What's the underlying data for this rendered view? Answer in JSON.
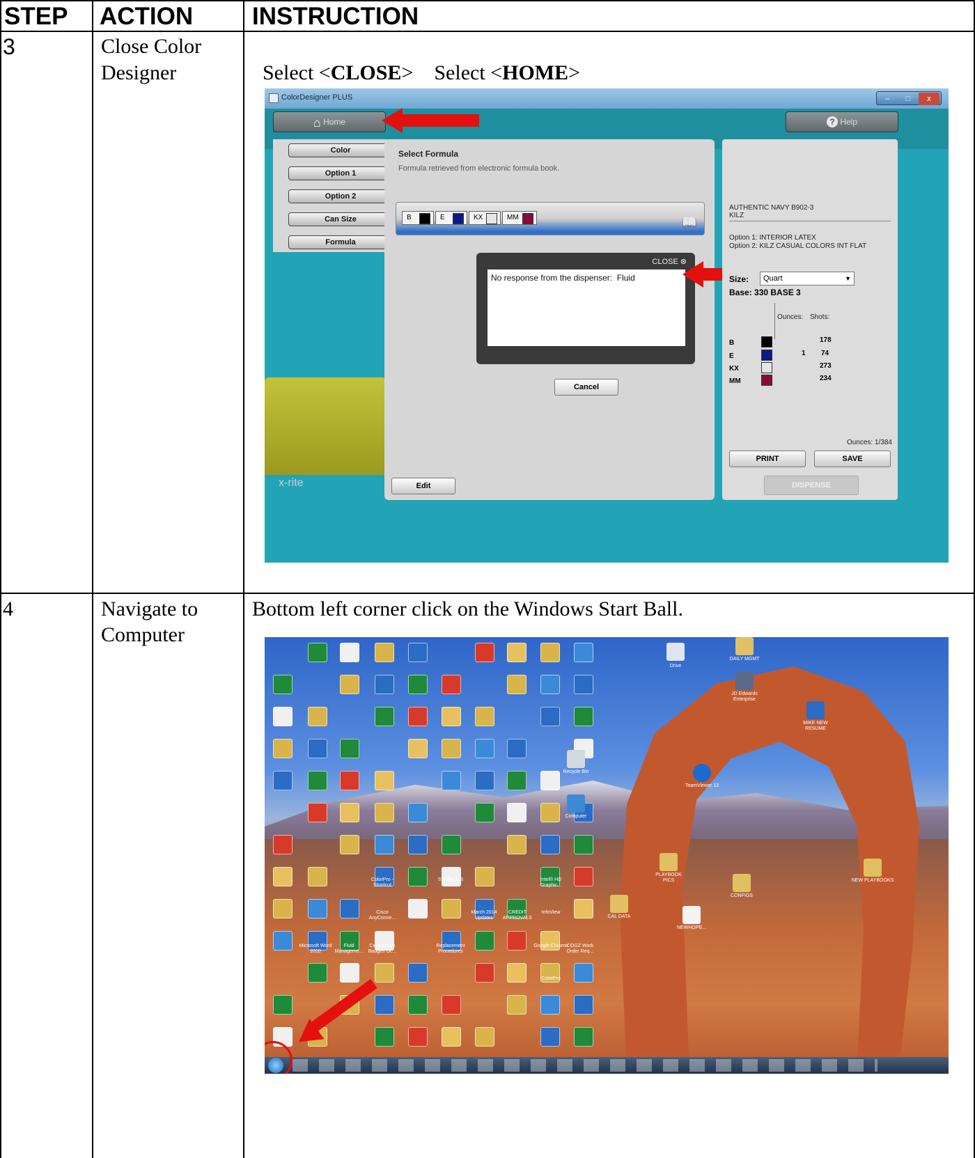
{
  "table": {
    "headers": {
      "step": "STEP",
      "action": "ACTION",
      "instruction": "INSTRUCTION"
    },
    "rows": [
      {
        "step": "3",
        "action_line1": "Close Color",
        "action_line2": "Designer",
        "instruction_prefix1": "Select <",
        "instruction_bold1": "CLOSE",
        "instruction_suffix1": ">",
        "instruction_prefix2": "Select <",
        "instruction_bold2": "HOME",
        "instruction_suffix2": ">"
      },
      {
        "step": "4",
        "action_line1": "Navigate to",
        "action_line2": "Computer",
        "instruction": "Bottom left corner click on the Windows Start Ball."
      }
    ]
  },
  "screenshot1": {
    "window_title": "ColorDesigner PLUS",
    "home_label": "Home",
    "help_label": "Help",
    "nav": [
      "Color",
      "Option 1",
      "Option 2",
      "Can Size",
      "Formula"
    ],
    "select_formula_title": "Select Formula",
    "select_formula_desc": "Formula retrieved from electronic formula book.",
    "colorants": [
      {
        "code": "B",
        "color": "#000000"
      },
      {
        "code": "E",
        "color": "#0a1a8a"
      },
      {
        "code": "KX",
        "color": "#e0e0e0"
      },
      {
        "code": "MM",
        "color": "#8a0a3a"
      }
    ],
    "dialog_close": "CLOSE ⊗",
    "dialog_message": "No response from the dispenser:  Fluid",
    "cancel_label": "Cancel",
    "edit_label": "Edit",
    "product_name": "AUTHENTIC NAVY B902-3",
    "brand": "KILZ",
    "option1": "Option 1:  INTERIOR LATEX",
    "option2": "Option 2:  KILZ CASUAL COLORS INT FLAT",
    "size_label": "Size:",
    "size_value": "Quart",
    "base_label": "Base:  330 BASE 3",
    "ounces_header": "Ounces:",
    "shots_header": "Shots:",
    "formula_rows": [
      {
        "code": "B",
        "color": "#000000",
        "ounces": "",
        "shots": "178"
      },
      {
        "code": "E",
        "color": "#0a1a8a",
        "ounces": "1",
        "shots": "74"
      },
      {
        "code": "KX",
        "color": "#e6e6e6",
        "ounces": "",
        "shots": "273"
      },
      {
        "code": "MM",
        "color": "#8a0a3a",
        "ounces": "",
        "shots": "234"
      }
    ],
    "ounces_total": "Ounces: 1/384",
    "print_label": "PRINT",
    "save_label": "SAVE",
    "dispense_label": "DISPENSE",
    "brand_logo": "x-rite"
  },
  "screenshot2": {
    "desktop_labels": [
      "Drive",
      "DAILY MGMT",
      "JD Edwards Enterprise",
      "MIKE NEW RESUME",
      "Recycle Bin",
      "TeamViewer 13",
      "Computer",
      "PLAYBOOK PICS",
      "NEW PLAYBOOKS",
      "CONFIGS",
      "CAL DATA",
      "NEWHOPE...",
      "Intel® HD Graphic...",
      "InfoView",
      "Google Chrome",
      "COGZ Work Order Req...",
      "ColorPro",
      "Microsoft Word 2010",
      "Fluid Manageme...",
      "Certification Badges Oc...",
      "Replacement Procedures",
      "Cisco AnyConne...",
      "March 2014 Updates",
      "CREDIT APPROVALS",
      "ColorPro - Shortcut",
      "SW PACKS"
    ]
  }
}
